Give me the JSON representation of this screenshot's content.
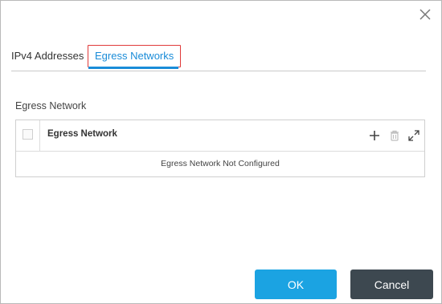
{
  "dialog": {
    "close_icon": "close-icon"
  },
  "tabs": [
    {
      "label": "IPv4 Addresses",
      "active": false
    },
    {
      "label": "Egress Networks",
      "active": true
    }
  ],
  "section": {
    "label": "Egress Network"
  },
  "grid": {
    "column_header": "Egress Network",
    "icons": [
      "plus-icon",
      "trash-icon",
      "expand-icon"
    ],
    "empty_message": "Egress Network Not Configured"
  },
  "footer": {
    "ok_label": "OK",
    "cancel_label": "Cancel"
  },
  "colors": {
    "accent": "#1a8cd8",
    "ok_button": "#1ba3e2",
    "cancel_button": "#3d4850",
    "highlight_border": "#e03a3a"
  }
}
